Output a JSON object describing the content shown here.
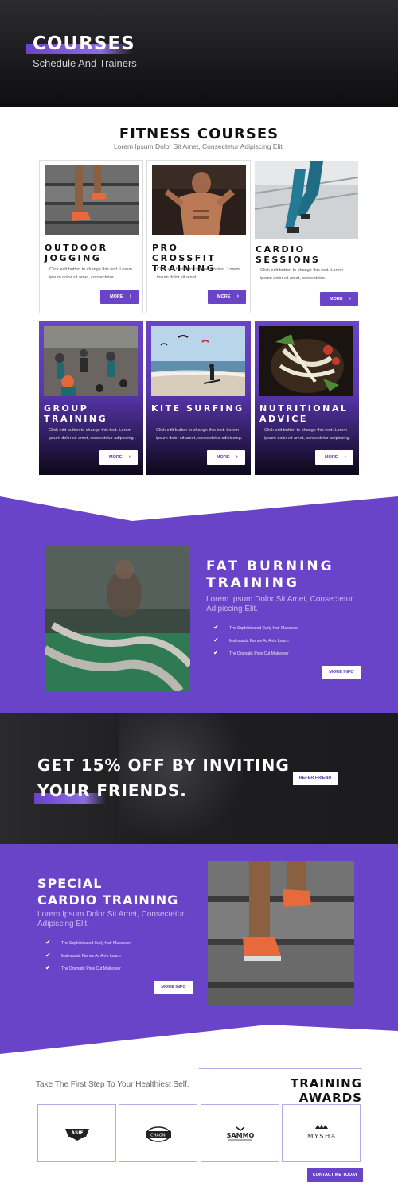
{
  "hero": {
    "title": "COURSES",
    "subtitle": "Schedule And Trainers"
  },
  "fitness": {
    "title": "FITNESS COURSES",
    "subtitle": "Lorem Ipsum Dolor Sit Amet, Consectetur Adipiscing Elit.",
    "cards": [
      {
        "title": "OUTDOOR JOGGING",
        "text": "Click edit button to change this text. Lorem ipsum dolor sit amet, consectetur.",
        "button": "MORE"
      },
      {
        "title": "PRO CROSSFIT TRAINING",
        "text": "Click edit button to change this text. Lorem ipsum dolor sit amet.",
        "button": "MORE"
      },
      {
        "title": "CARDIO SESSIONS",
        "text": "Click edit button to change this text. Lorem ipsum dolor sit amet, consectetur.",
        "button": "MORE"
      },
      {
        "title": "GROUP TRAINING",
        "text": "Click edit button to change this text. Lorem ipsum dolor sit amet, consectetur adipiscing .",
        "button": "MORE"
      },
      {
        "title": "KITE SURFING",
        "text": "Click edit button to change this text. Lorem ipsum dolor sit amet, consectetur adipiscing.",
        "button": "MORE"
      },
      {
        "title": "NUTRITIONAL ADVICE",
        "text": "Click edit button to change this text. Lorem ipsum dolor sit amet, consectetur adipiscing.",
        "button": "MORE"
      }
    ]
  },
  "fat_burning": {
    "title_line1": "FAT BURNING",
    "title_line2": "TRAINING",
    "subtitle": "Lorem Ipsum Dolor Sit Amet, Consectetur Adipiscing Elit.",
    "checks": [
      "The Sophisticated Curly Hair Makeover",
      "Malesuada Fames Ac Ante Ipsum",
      "The Dramatic Pixie Cut Makeover"
    ],
    "button": "MORE INFO"
  },
  "invite": {
    "line1": "GET 15% OFF BY INVITING",
    "line2": "YOUR FRIENDS.",
    "button": "REFER FRIEND"
  },
  "cardio": {
    "title_line1": "SPECIAL",
    "title_line2": "CARDIO TRAINING",
    "subtitle": "Lorem Ipsum Dolor Sit Amet, Consectetur Adipiscing Elit.",
    "checks": [
      "The Sophisticated Curly Hair Makeover",
      "Malesuada Fames Ac Ante Ipsum",
      "The Dramatic Pixie Cut Makeover"
    ],
    "button": "MORE INFO"
  },
  "awards": {
    "tagline": "Take The First Step To Your Healthiest Self.",
    "title": "TRAINING AWARDS",
    "logos": [
      "ASIF",
      "CHAONI",
      "SAMMO",
      "MYSHA"
    ],
    "button": "CONTACT ME TODAY"
  },
  "colors": {
    "accent": "#6a44c8",
    "dark": "#111111"
  },
  "icons": {
    "check": "check-icon",
    "arrow": "chevron-right-icon"
  }
}
